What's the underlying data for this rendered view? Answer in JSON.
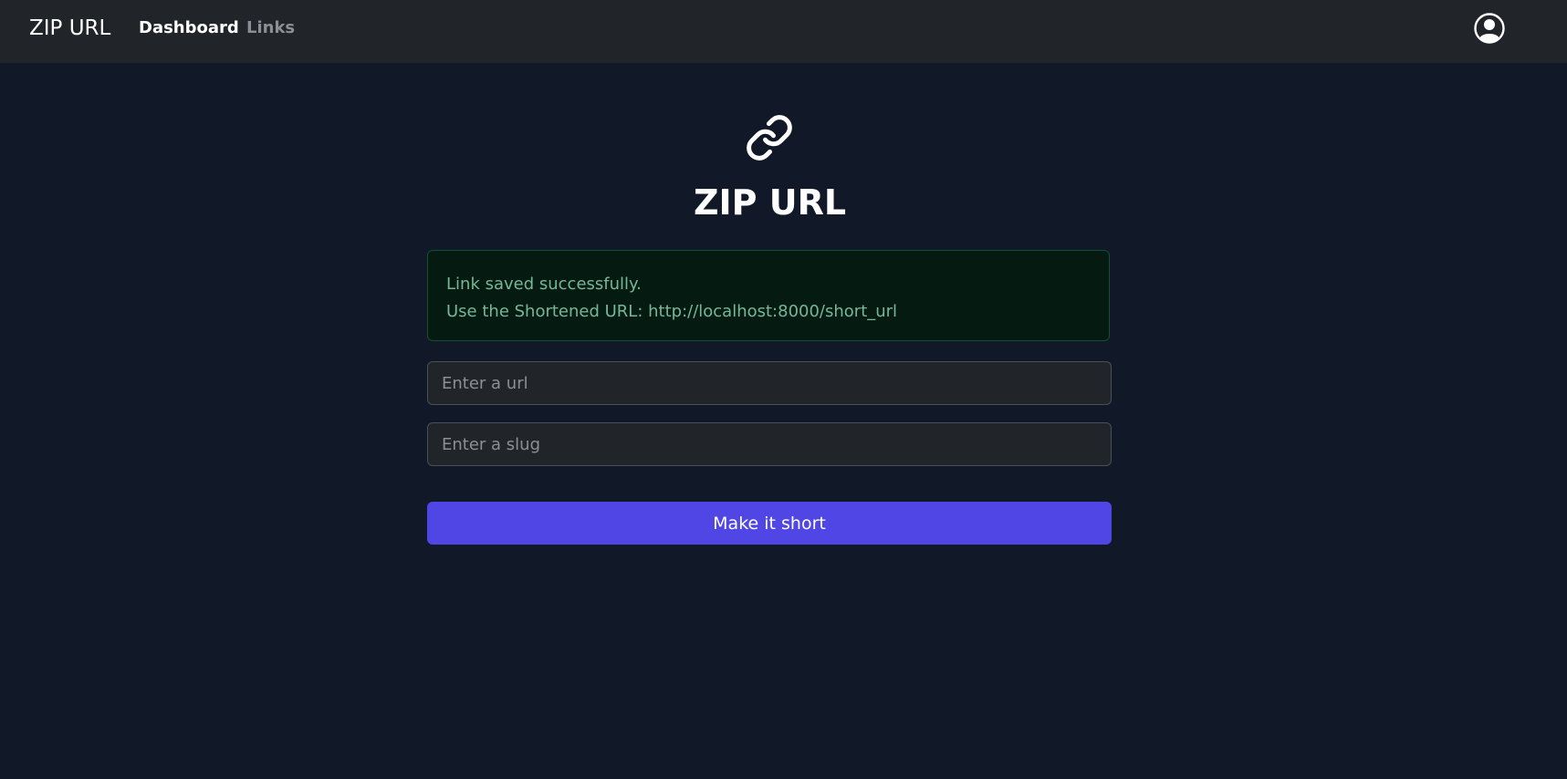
{
  "navbar": {
    "brand": "ZIP URL",
    "links": [
      {
        "label": "Dashboard",
        "active": true
      },
      {
        "label": "Links",
        "active": false
      }
    ],
    "profile_icon": "user-circle-icon"
  },
  "hero": {
    "icon": "link-icon",
    "title": "ZIP URL"
  },
  "alert": {
    "line1": "Link saved successfully.",
    "line2": "Use the Shortened URL: http://localhost:8000/short_url"
  },
  "form": {
    "url_placeholder": "Enter a url",
    "url_value": "",
    "slug_placeholder": "Enter a slug",
    "slug_value": "",
    "submit_label": "Make it short"
  },
  "colors": {
    "background": "#111827",
    "navbar": "#212529",
    "accent": "#4f46e5",
    "success_text": "#75b798",
    "success_bg": "#051b11"
  }
}
